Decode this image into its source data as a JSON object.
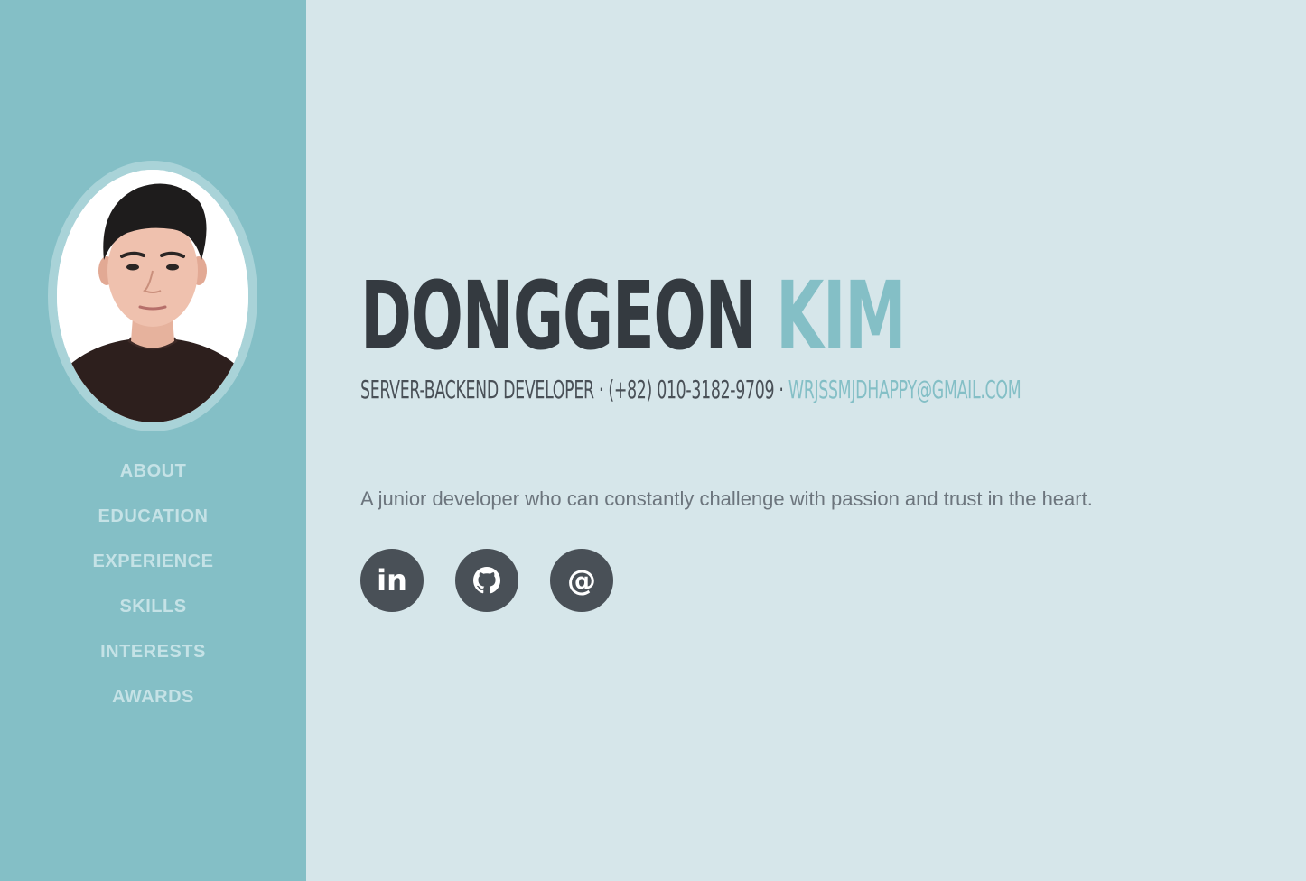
{
  "sidebar": {
    "nav": [
      {
        "label": "ABOUT"
      },
      {
        "label": "EDUCATION"
      },
      {
        "label": "EXPERIENCE"
      },
      {
        "label": "SKILLS"
      },
      {
        "label": "INTERESTS"
      },
      {
        "label": "AWARDS"
      }
    ]
  },
  "about": {
    "first_name": "DONGGEON",
    "last_name": "KIM",
    "role": "SERVER-BACKEND DEVELOPER",
    "separator": "·",
    "phone": "(+82) 010-3182-9709",
    "email": "WRJSSMJDHAPPY@GMAIL.COM",
    "lead": "A junior developer who can constantly challenge with passion and trust in the heart."
  },
  "social": [
    {
      "icon": "linkedin-icon",
      "glyph": "in"
    },
    {
      "icon": "github-icon"
    },
    {
      "icon": "at-sign-icon",
      "glyph": "@"
    }
  ],
  "colors": {
    "primary": "#84bfc6",
    "background": "#d6e6ea",
    "dark": "#343a40",
    "nav_text": "#c5e2e6",
    "social_bg": "#495057"
  }
}
